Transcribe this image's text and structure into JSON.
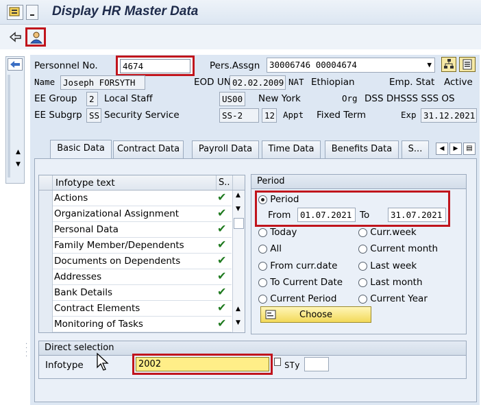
{
  "window": {
    "title": "Display HR Master Data"
  },
  "header": {
    "personnel_no_label": "Personnel No.",
    "personnel_no_value": "4674",
    "pers_assgn_label": "Pers.Assgn",
    "pers_assgn_value": "30006746 00004674",
    "name_label": "Name",
    "name_value": "Joseph FORSYTH",
    "eod_label": "EOD UN",
    "eod_value": "02.02.2009",
    "nat_label": "NAT",
    "nat_value": "Ethiopian",
    "emp_stat_label": "Emp. Stat",
    "emp_stat_value": "Active",
    "ee_group_label": "EE Group",
    "ee_group_code": "2",
    "ee_group_text": "Local Staff",
    "pa_code": "US00",
    "pa_text": "New York",
    "org_label": "Org",
    "org_value": "DSS DHSSS SSS OS",
    "ee_subgrp_label": "EE Subgrp",
    "ee_subgrp_code": "SS",
    "ee_subgrp_text": "Security Service",
    "grade_value": "SS-2",
    "step_value": "12",
    "appt_label": "Appt",
    "appt_value": "Fixed Term",
    "exp_label": "Exp",
    "exp_value": "31.12.2021"
  },
  "tabs": [
    {
      "label": "Basic Data"
    },
    {
      "label": "Contract Data"
    },
    {
      "label": "Payroll Data"
    },
    {
      "label": "Time Data"
    },
    {
      "label": "Benefits Data"
    },
    {
      "label": "S..."
    }
  ],
  "infotype_list": {
    "col_text": "Infotype text",
    "col_status": "S..",
    "items": [
      {
        "label": "Actions"
      },
      {
        "label": "Organizational Assignment"
      },
      {
        "label": "Personal Data"
      },
      {
        "label": "Family Member/Dependents"
      },
      {
        "label": "Documents on Dependents"
      },
      {
        "label": "Addresses"
      },
      {
        "label": "Bank Details"
      },
      {
        "label": "Contract Elements"
      },
      {
        "label": "Monitoring of Tasks"
      }
    ]
  },
  "period": {
    "group_title": "Period",
    "period_option": "Period",
    "from_label": "From",
    "from_value": "01.07.2021",
    "to_label": "To",
    "to_value": "31.07.2021",
    "options": {
      "today": "Today",
      "curr_week": "Curr.week",
      "all": "All",
      "current_month": "Current month",
      "from_curr_date": "From curr.date",
      "last_week": "Last week",
      "to_current_date": "To Current Date",
      "last_month": "Last month",
      "current_period": "Current Period",
      "current_year": "Current Year"
    },
    "choose_label": "Choose"
  },
  "direct_selection": {
    "group_title": "Direct selection",
    "infotype_label": "Infotype",
    "infotype_value": "2002",
    "sty_label": "STy",
    "sty_value": ""
  },
  "colors": {
    "highlight_red": "#c0141c",
    "selected_field": "#ffee88",
    "check_green": "#1f7a1f"
  }
}
